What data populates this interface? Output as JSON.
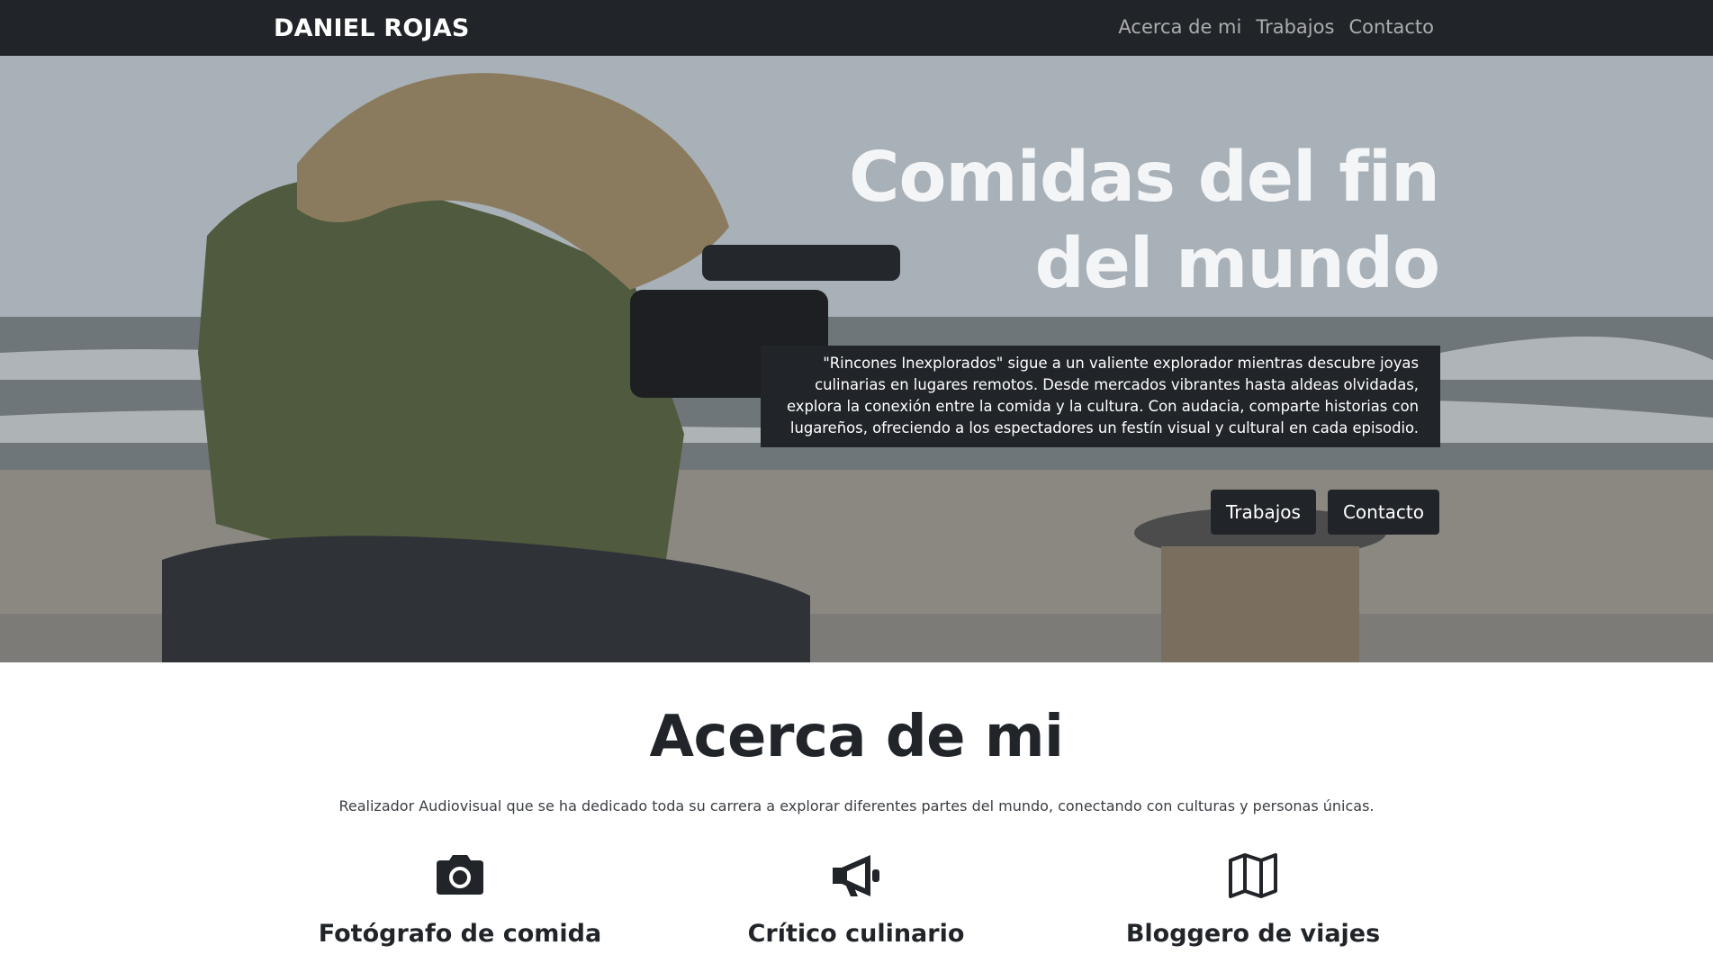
{
  "navbar": {
    "brand": "DANIEL ROJAS",
    "links": [
      "Acerca de mi",
      "Trabajos",
      "Contacto"
    ]
  },
  "hero": {
    "title_line1": "Comidas del fin",
    "title_line2": "del mundo",
    "description": "\"Rincones Inexplorados\" sigue a un valiente explorador mientras descubre joyas culinarias en lugares remotos. Desde mercados vibrantes hasta aldeas olvidadas, explora la conexión entre la comida y la cultura. Con audacia, comparte historias con lugareños, ofreciendo a los espectadores un festín visual y cultural en cada episodio.",
    "buttons": [
      "Trabajos",
      "Contacto"
    ]
  },
  "about": {
    "title": "Acerca de mi",
    "text": "Realizador Audiovisual que se ha dedicado toda su carrera a explorar diferentes partes del mundo, conectando con culturas y personas únicas.",
    "features": [
      {
        "icon": "camera-icon",
        "title": "Fotógrafo de comida"
      },
      {
        "icon": "megaphone-icon",
        "title": "Crítico culinario"
      },
      {
        "icon": "map-icon",
        "title": "Bloggero de viajes"
      }
    ]
  },
  "colors": {
    "dark": "#212529",
    "nav_link": "#a6a8aa",
    "white": "#ffffff"
  }
}
